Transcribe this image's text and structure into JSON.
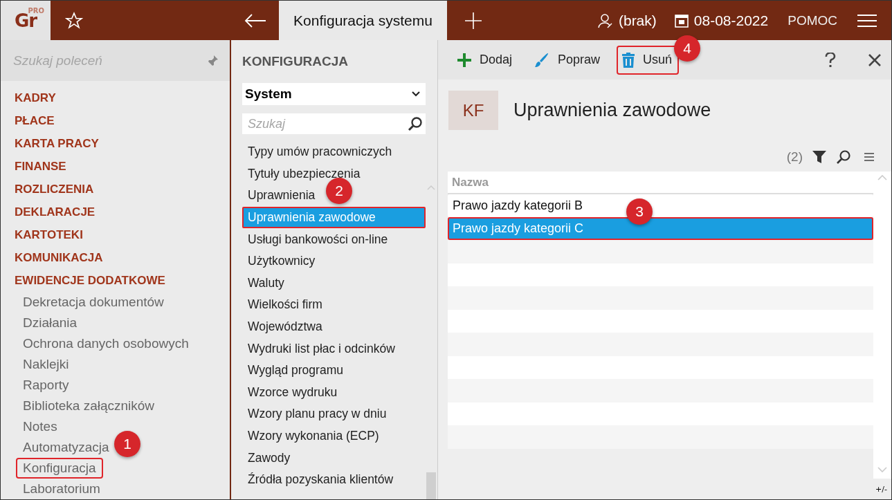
{
  "app": {
    "logo": "Gr",
    "logo_badge": "PRO"
  },
  "top_bar": {
    "tab": "Konfiguracja systemu",
    "user": "(brak)",
    "date": "08-08-2022",
    "help": "POMOC"
  },
  "sidebar": {
    "search": {
      "placeholder": "Szukaj poleceń"
    },
    "items": [
      {
        "kind": "section",
        "label": "KADRY",
        "highlighted": false
      },
      {
        "kind": "section",
        "label": "PŁACE",
        "highlighted": false
      },
      {
        "kind": "section",
        "label": "KARTA PRACY",
        "highlighted": false
      },
      {
        "kind": "section",
        "label": "FINANSE",
        "highlighted": false
      },
      {
        "kind": "section",
        "label": "ROZLICZENIA",
        "highlighted": false
      },
      {
        "kind": "section",
        "label": "DEKLARACJE",
        "highlighted": false
      },
      {
        "kind": "section",
        "label": "KARTOTEKI",
        "highlighted": false
      },
      {
        "kind": "section",
        "label": "KOMUNIKACJA",
        "highlighted": false
      },
      {
        "kind": "section",
        "label": "EWIDENCJE DODATKOWE",
        "highlighted": false
      },
      {
        "kind": "sub",
        "label": "Dekretacja dokumentów",
        "highlighted": false
      },
      {
        "kind": "sub",
        "label": "Działania",
        "highlighted": false
      },
      {
        "kind": "sub",
        "label": "Ochrona danych osobowych",
        "highlighted": false
      },
      {
        "kind": "sub",
        "label": "Naklejki",
        "highlighted": false
      },
      {
        "kind": "sub",
        "label": "Raporty",
        "highlighted": false
      },
      {
        "kind": "sub",
        "label": "Biblioteka załączników",
        "highlighted": false
      },
      {
        "kind": "sub",
        "label": "Notes",
        "highlighted": false
      },
      {
        "kind": "sub",
        "label": "Automatyzacja",
        "highlighted": false
      },
      {
        "kind": "sub",
        "label": "Konfiguracja",
        "highlighted": true
      },
      {
        "kind": "sub",
        "label": "Laboratorium",
        "highlighted": false
      }
    ]
  },
  "config": {
    "title": "KONFIGURACJA",
    "dropdown": "System",
    "search": {
      "placeholder": "Szukaj"
    },
    "items": [
      {
        "label": "Typy umów pracowniczych",
        "selected": false
      },
      {
        "label": "Tytuły ubezpieczenia",
        "selected": false
      },
      {
        "label": "Uprawnienia",
        "selected": false
      },
      {
        "label": "Uprawnienia zawodowe",
        "selected": true
      },
      {
        "label": "Usługi bankowości on-line",
        "selected": false
      },
      {
        "label": "Użytkownicy",
        "selected": false
      },
      {
        "label": "Waluty",
        "selected": false
      },
      {
        "label": "Wielkości firm",
        "selected": false
      },
      {
        "label": "Województwa",
        "selected": false
      },
      {
        "label": "Wydruki list płac i odcinków",
        "selected": false
      },
      {
        "label": "Wygląd programu",
        "selected": false
      },
      {
        "label": "Wzorce wydruku",
        "selected": false
      },
      {
        "label": "Wzory planu pracy w dniu",
        "selected": false
      },
      {
        "label": "Wzory wykonania (ECP)",
        "selected": false
      },
      {
        "label": "Zawody",
        "selected": false
      },
      {
        "label": "Źródła pozyskania klientów",
        "selected": false
      }
    ]
  },
  "toolbar": {
    "buttons": [
      {
        "kind": "add",
        "label": "Dodaj",
        "highlighted": false
      },
      {
        "kind": "edit",
        "label": "Popraw",
        "highlighted": false
      },
      {
        "kind": "delete",
        "label": "Usuń",
        "highlighted": true
      }
    ]
  },
  "detail": {
    "badge": "KF",
    "title": "Uprawnienia zawodowe",
    "count": "(2)",
    "table": {
      "columns": [
        "Nazwa"
      ],
      "rows": [
        {
          "cells": [
            "Prawo jazdy kategorii B"
          ],
          "selected": false
        },
        {
          "cells": [
            "Prawo jazdy kategorii C"
          ],
          "selected": true
        }
      ]
    },
    "footer": "+/-"
  },
  "callouts": [
    {
      "label": "1"
    },
    {
      "label": "2"
    },
    {
      "label": "3"
    },
    {
      "label": "4"
    }
  ]
}
